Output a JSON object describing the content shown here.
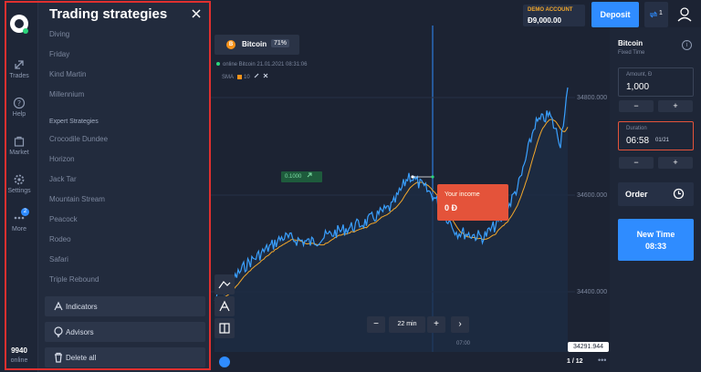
{
  "nav": {
    "items": [
      {
        "label": "Trades",
        "icon": "trades-icon"
      },
      {
        "label": "Help",
        "icon": "help-icon"
      },
      {
        "label": "Market",
        "icon": "market-icon"
      },
      {
        "label": "Settings",
        "icon": "gear-icon"
      },
      {
        "label": "More",
        "icon": "more-icon",
        "badge": "2"
      }
    ],
    "balance": "9940",
    "balance_label": "online"
  },
  "panel": {
    "title": "Trading strategies",
    "strategies": [
      "Diving",
      "Friday",
      "Kind Martin",
      "Millennium"
    ],
    "expert_header": "Expert Strategies",
    "expert_strategies": [
      "Crocodile Dundee",
      "Horizon",
      "Jack Tar",
      "Mountain Stream",
      "Peacock",
      "Rodeo",
      "Safari",
      "Triple Rebound"
    ],
    "buttons": [
      {
        "label": "Indicators",
        "icon": "indicators-icon"
      },
      {
        "label": "Advisors",
        "icon": "advisors-icon"
      },
      {
        "label": "Delete all",
        "icon": "trash-icon"
      }
    ]
  },
  "chart": {
    "asset": "Bitcoin",
    "coin_symbol": "B",
    "payout": "71%",
    "online_text": "online Bitcoin  21.01.2021 08:31:06",
    "sma_label": "SMA",
    "sma_period": "10",
    "green_tag": "0.1000",
    "prices": [
      "34800.000",
      "34600.000",
      "34400.000"
    ],
    "current_price": "34291.944",
    "time_label": "07:00",
    "income_title": "Your income",
    "income_value": "0 Đ",
    "zoom_minus": "−",
    "zoom_value": "22 min",
    "zoom_plus": "+",
    "zoom_next": "›",
    "pager": "1 / 12",
    "pager_more": "•••",
    "line_color": "#3aa0ff",
    "sma_color": "#f2a72b"
  },
  "account": {
    "demo_title": "DEMO ACCOUNT",
    "demo_balance": "Đ9,000.00",
    "deposit_label": "Deposit",
    "trades_count": "1"
  },
  "right": {
    "asset": "Bitcoin",
    "type": "Fixed Time",
    "amount_label": "Amount, Đ",
    "amount_value": "1,000",
    "duration_label": "Duration",
    "duration_value": "06:58",
    "duration_date": "01/21",
    "minus": "−",
    "plus": "+",
    "order_label": "Order",
    "newtime_label": "New Time",
    "newtime_value": "08:33"
  }
}
